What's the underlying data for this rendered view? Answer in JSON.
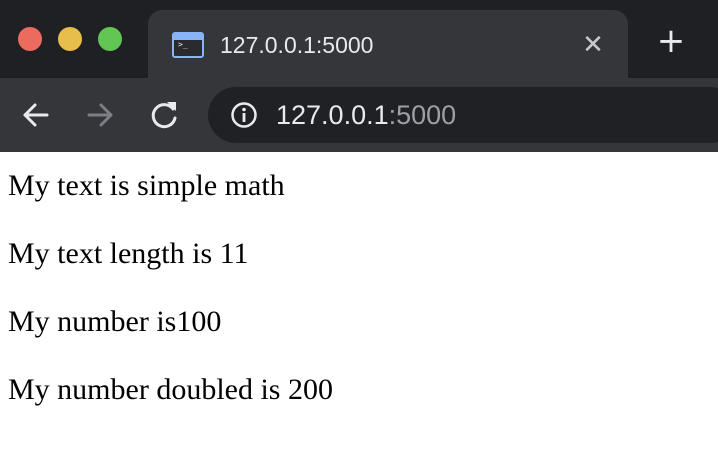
{
  "window": {
    "traffic_lights": {
      "close_color": "#ed6a5e",
      "minimize_color": "#e7be4c",
      "maximize_color": "#62c654"
    }
  },
  "tab": {
    "title": "127.0.0.1:5000",
    "favicon": "terminal-icon",
    "close_icon": "close-icon",
    "close_glyph": "✕"
  },
  "new_tab": {
    "icon": "plus-icon",
    "glyph": "+"
  },
  "toolbar": {
    "back_icon": "arrow-left-icon",
    "forward_icon": "arrow-right-icon",
    "reload_icon": "reload-icon",
    "info_icon": "info-icon",
    "url_host": "127.0.0.1",
    "url_port": ":5000"
  },
  "page": {
    "lines": [
      "My text is simple math",
      "My text length is 11",
      "My number is100",
      "My number doubled is 200"
    ]
  }
}
